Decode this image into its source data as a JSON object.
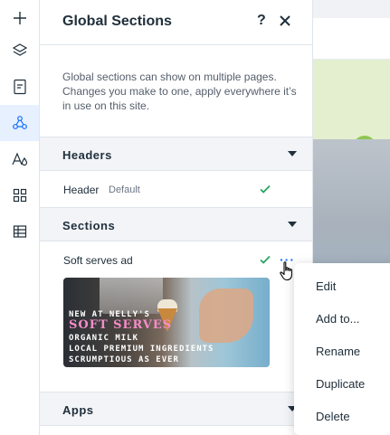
{
  "panel": {
    "title": "Global Sections",
    "help_label": "?",
    "description": "Global sections can show on multiple pages. Changes you make to one, apply everywhere it’s in use on this site."
  },
  "groups": {
    "headers": {
      "label": "Headers",
      "item_label": "Header",
      "item_sub": "Default"
    },
    "sections": {
      "label": "Sections",
      "item_label": "Soft serves ad",
      "more_label": "···"
    },
    "apps": {
      "label": "Apps"
    }
  },
  "ad": {
    "line1": "NEW AT NELLY'S",
    "line2": "SOFT SERVES",
    "line3": "ORGANIC MILK",
    "line4": "LOCAL PREMIUM INGREDIENTS",
    "line5": "SCRUMPTIOUS AS EVER"
  },
  "context_menu": {
    "items": [
      "Edit",
      "Add to...",
      "Rename",
      "Duplicate",
      "Delete"
    ]
  },
  "rail_icons": [
    "add-icon",
    "layers-icon",
    "pages-icon",
    "global-sections-icon",
    "theme-icon",
    "apps-icon",
    "table-icon"
  ],
  "colors": {
    "accent": "#116dff",
    "check": "#25a55f",
    "active_rail": "#e7f0ff",
    "ad_title_pink": "#f58cc9"
  }
}
